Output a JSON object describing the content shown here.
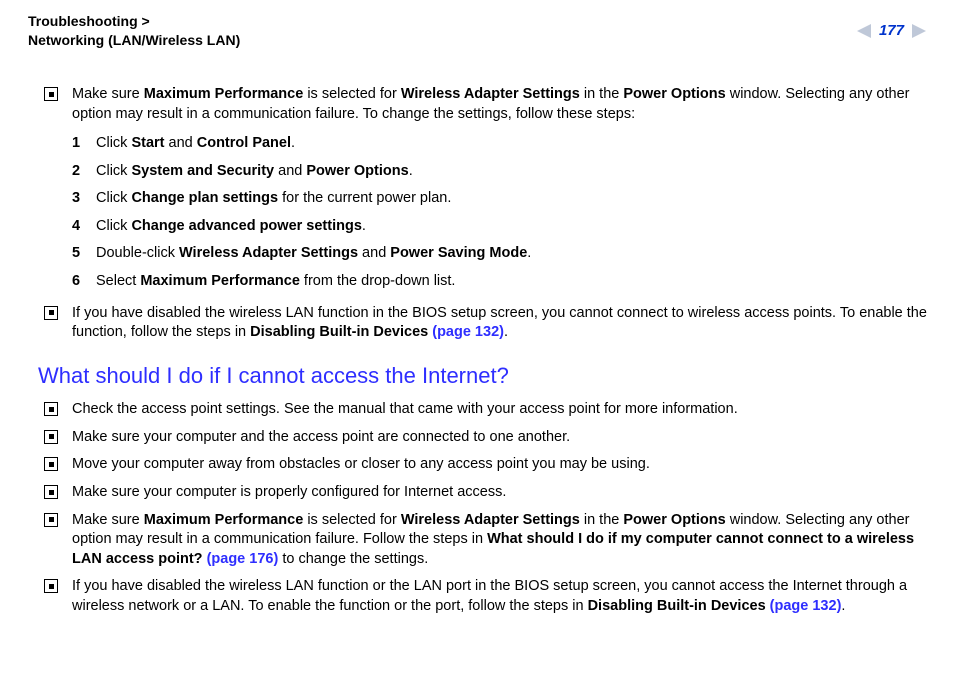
{
  "header": {
    "breadcrumb_line1": "Troubleshooting >",
    "breadcrumb_line2": "Networking (LAN/Wireless LAN)",
    "page_number": "177"
  },
  "top_bullet": {
    "pre": "Make sure ",
    "b1": "Maximum Performance",
    "mid1": " is selected for ",
    "b2": "Wireless Adapter Settings",
    "mid2": " in the ",
    "b3": "Power Options",
    "tail": " window. Selecting any other option may result in a communication failure. To change the settings, follow these steps:"
  },
  "steps": [
    {
      "n": "1",
      "pre": "Click ",
      "b1": "Start",
      "mid": " and ",
      "b2": "Control Panel",
      "tail": "."
    },
    {
      "n": "2",
      "pre": "Click ",
      "b1": "System and Security",
      "mid": " and ",
      "b2": "Power Options",
      "tail": "."
    },
    {
      "n": "3",
      "pre": "Click ",
      "b1": "Change plan settings",
      "mid": "",
      "b2": "",
      "tail": " for the current power plan."
    },
    {
      "n": "4",
      "pre": "Click ",
      "b1": "Change advanced power settings",
      "mid": "",
      "b2": "",
      "tail": "."
    },
    {
      "n": "5",
      "pre": "Double-click ",
      "b1": "Wireless Adapter Settings",
      "mid": " and ",
      "b2": "Power Saving Mode",
      "tail": "."
    },
    {
      "n": "6",
      "pre": "Select ",
      "b1": "Maximum Performance",
      "mid": "",
      "b2": "",
      "tail": " from the drop-down list."
    }
  ],
  "bios_bullet": {
    "pre": "If you have disabled the wireless LAN function in the BIOS setup screen, you cannot connect to wireless access points. To enable the function, follow the steps in ",
    "b1": "Disabling Built-in Devices ",
    "link": "(page 132)",
    "tail": "."
  },
  "section2_title": "What should I do if I cannot access the Internet?",
  "s2_bullets_simple": [
    "Check the access point settings. See the manual that came with your access point for more information.",
    "Make sure your computer and the access point are connected to one another.",
    "Move your computer away from obstacles or closer to any access point you may be using.",
    "Make sure your computer is properly configured for Internet access."
  ],
  "s2_perf_bullet": {
    "pre": "Make sure ",
    "b1": "Maximum Performance",
    "mid1": " is selected for ",
    "b2": "Wireless Adapter Settings",
    "mid2": " in the ",
    "b3": "Power Options",
    "mid3": " window. Selecting any other option may result in a communication failure. Follow the steps in ",
    "b4": "What should I do if my computer cannot connect to a wireless LAN access point? ",
    "link": "(page 176)",
    "tail": " to change the settings."
  },
  "s2_bios_bullet": {
    "pre": "If you have disabled the wireless LAN function or the LAN port in the BIOS setup screen, you cannot access the Internet through a wireless network or a LAN. To enable the function or the port, follow the steps in ",
    "b1": "Disabling Built-in Devices ",
    "link": "(page 132)",
    "tail": "."
  }
}
